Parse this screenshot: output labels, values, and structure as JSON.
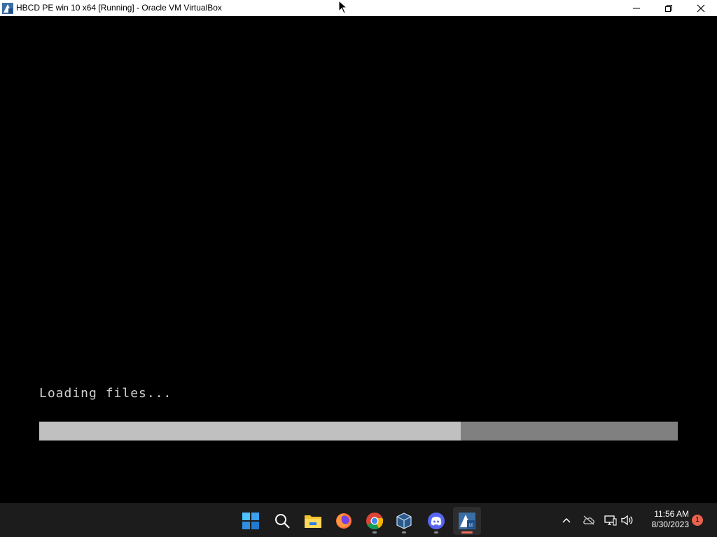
{
  "window": {
    "title": "HBCD PE win 10 x64 [Running] - Oracle VM VirtualBox",
    "app_icon": "virtualbox-icon",
    "controls": {
      "minimize_icon": "minimize-icon",
      "maximize_icon": "restore-icon",
      "close_icon": "close-icon"
    }
  },
  "vm_screen": {
    "status_text": "Loading files...",
    "progress_fraction": 0.66,
    "colors": {
      "background": "#000000",
      "text": "#d0d0d0",
      "progress_fill": "#c0c0c0",
      "progress_track": "#808080"
    }
  },
  "taskbar": {
    "apps": [
      {
        "name": "start-button",
        "icon": "windows-start-icon",
        "running": false,
        "active": false
      },
      {
        "name": "search-button",
        "icon": "search-icon",
        "running": false,
        "active": false
      },
      {
        "name": "file-explorer",
        "icon": "folder-icon",
        "running": false,
        "active": false
      },
      {
        "name": "firefox",
        "icon": "firefox-icon",
        "running": false,
        "active": false
      },
      {
        "name": "chrome",
        "icon": "chrome-icon",
        "running": true,
        "active": false
      },
      {
        "name": "virtualbox-manager",
        "icon": "virtualbox-cube-icon",
        "running": true,
        "active": false
      },
      {
        "name": "discord",
        "icon": "discord-icon",
        "running": true,
        "active": false
      },
      {
        "name": "virtualbox-vm",
        "icon": "virtualbox-icon",
        "running": true,
        "active": true
      }
    ],
    "tray": {
      "icons": [
        "chevron-up-icon",
        "cloud-offline-icon",
        "network-icon",
        "volume-icon"
      ],
      "time": "11:56 AM",
      "date": "8/30/2023",
      "notification_count": "1"
    }
  }
}
